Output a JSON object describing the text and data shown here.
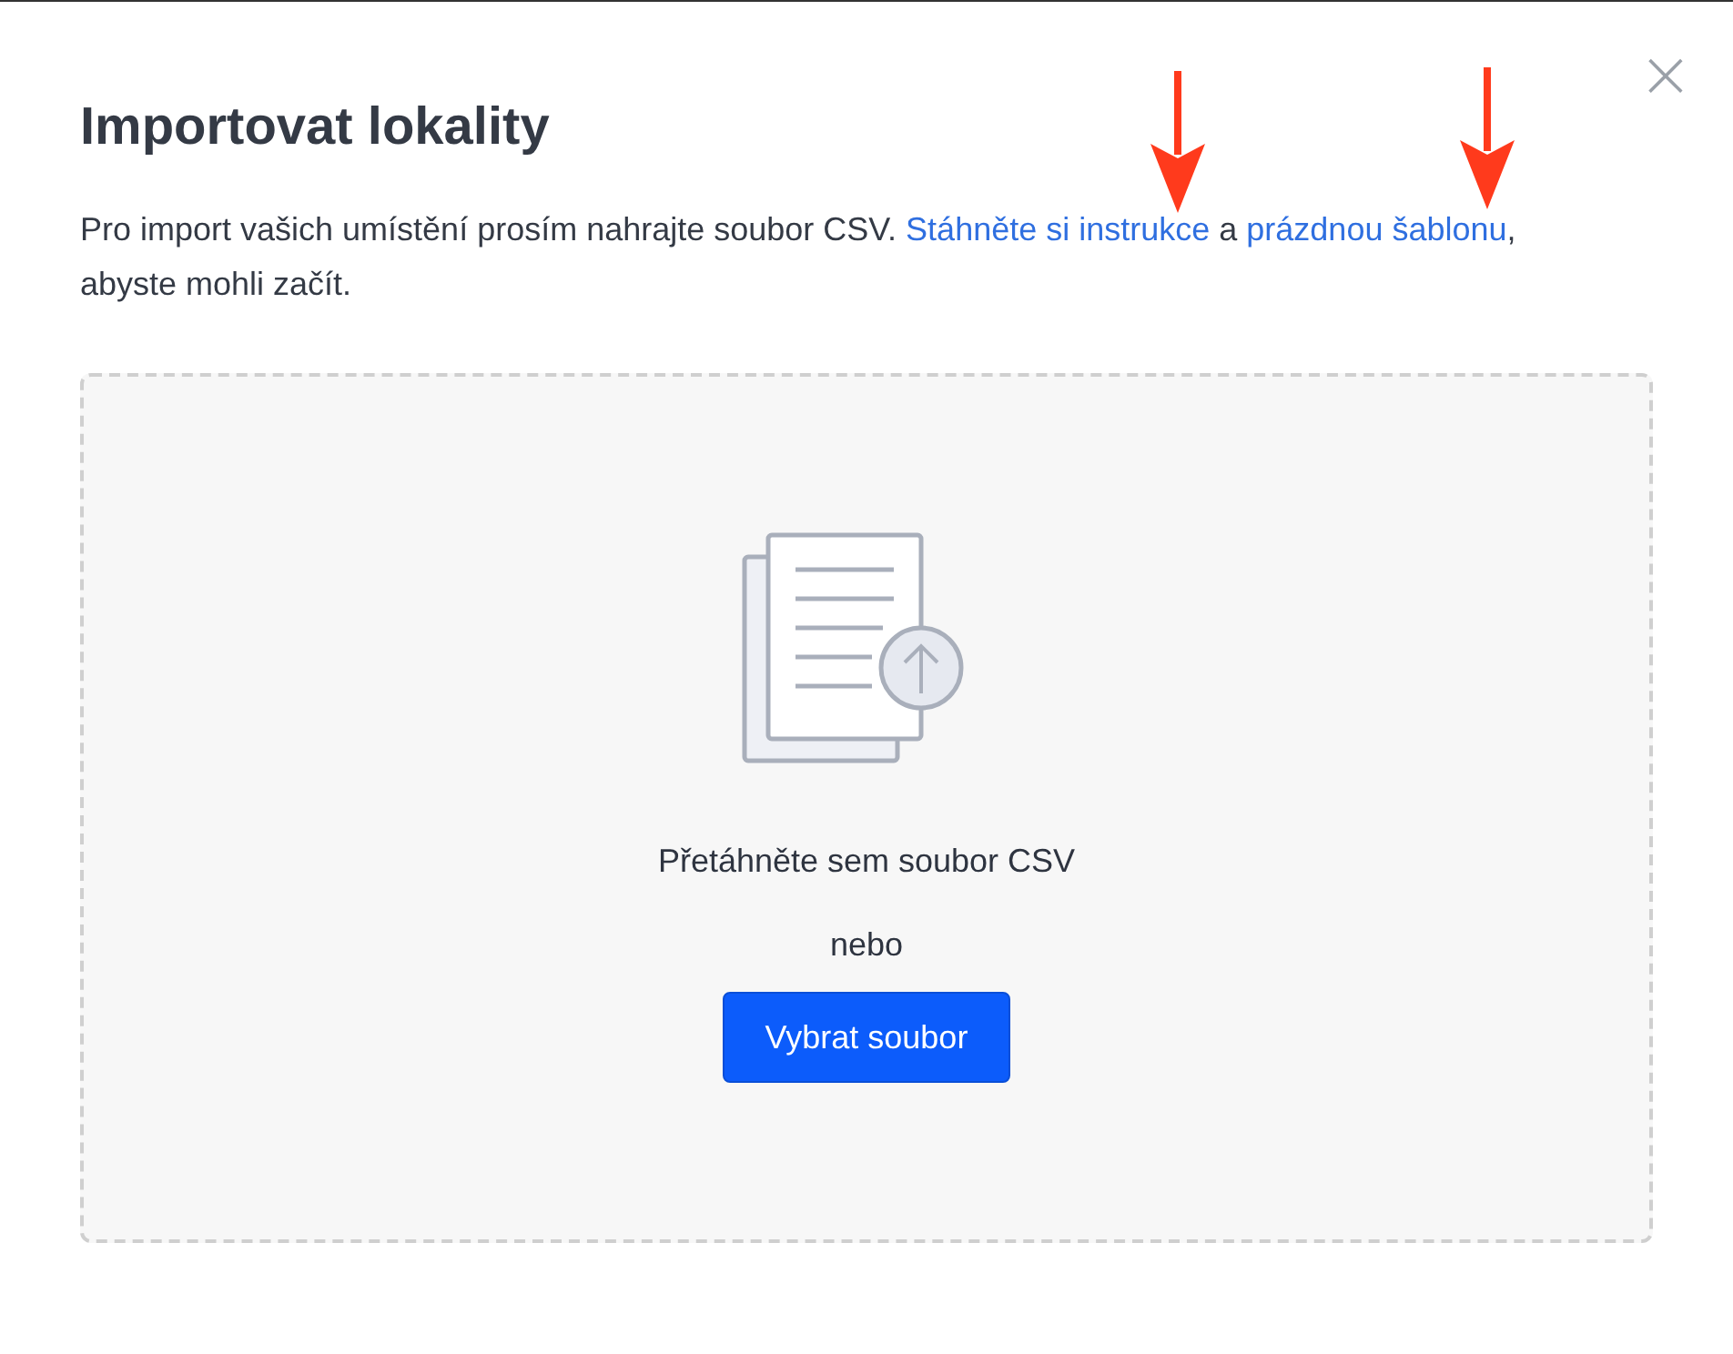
{
  "dialog": {
    "title": "Importovat lokality",
    "close": "×",
    "intro": [
      {
        "kind": "text",
        "text": "Pro import vašich umístění prosím nahrajte soubor CSV. "
      },
      {
        "kind": "link",
        "text": "Stáhněte si instrukce"
      },
      {
        "kind": "text",
        "text": " a "
      },
      {
        "kind": "link",
        "text": "prázdnou šablonu"
      },
      {
        "kind": "text",
        "text": ", abyste mohli začít."
      }
    ],
    "dropzone": {
      "prompt": "Přetáhněte sem soubor CSV",
      "separator": "nebo",
      "button": "Vybrat soubor"
    }
  }
}
